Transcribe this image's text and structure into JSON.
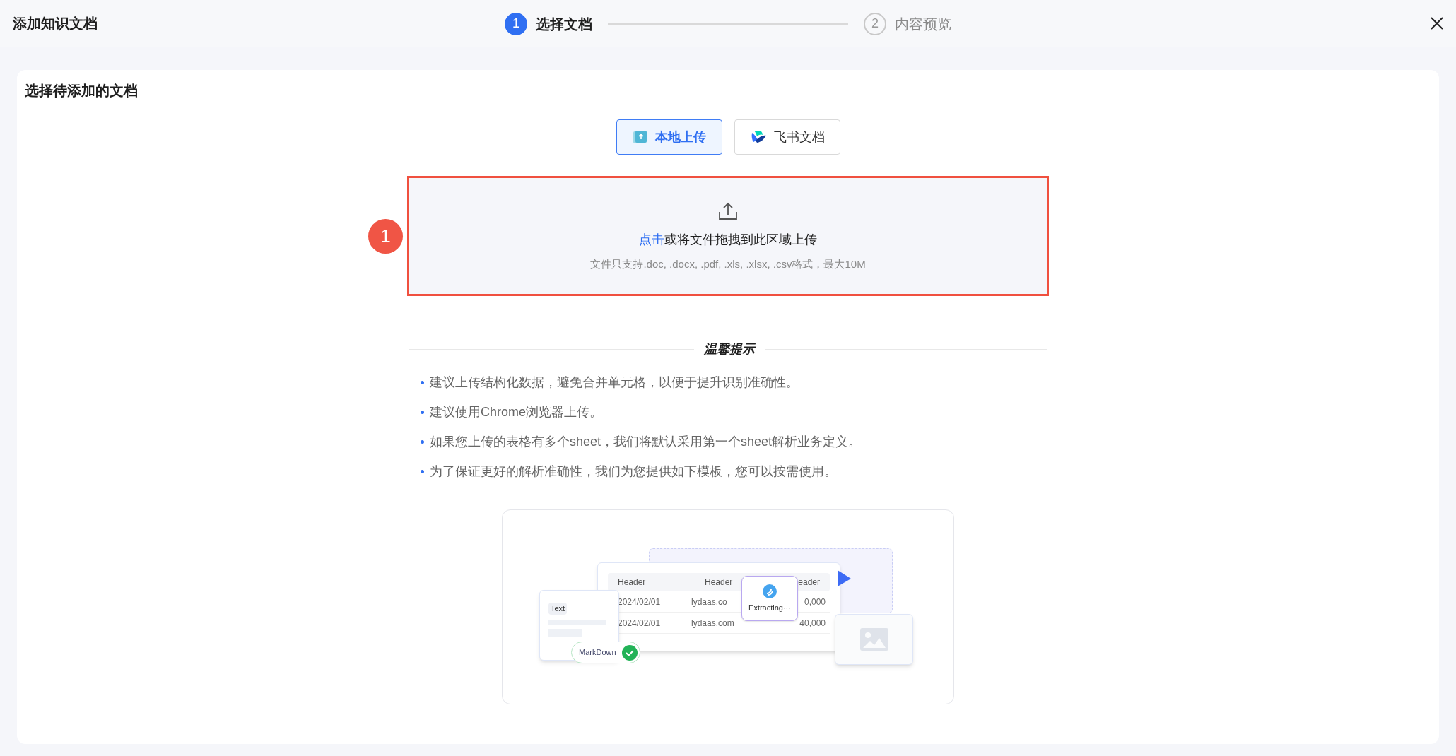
{
  "header": {
    "title": "添加知识文档",
    "steps": [
      {
        "number": "1",
        "label": "选择文档",
        "selected": true
      },
      {
        "number": "2",
        "label": "内容预览",
        "selected": false
      }
    ]
  },
  "panel": {
    "title": "选择待添加的文档",
    "sources": [
      {
        "label": "本地上传",
        "kind": "local",
        "selected": true
      },
      {
        "label": "飞书文档",
        "kind": "feishu",
        "selected": false
      }
    ],
    "dropzone": {
      "link": "点击",
      "text": "或将文件拖拽到此区域上传",
      "hint": "文件只支持.doc, .docx, .pdf, .xls, .xlsx, .csv格式，最大10M",
      "highlighted": true
    },
    "annotation": "1",
    "tips_title": "温馨提示",
    "tips": [
      "建议上传结构化数据，避免合并单元格，以便于提升识别准确性。",
      "建议使用Chrome浏览器上传。",
      "如果您上传的表格有多个sheet，我们将默认采用第一个sheet解析业务定义。",
      "为了保证更好的解析准确性，我们为您提供如下模板，您可以按需使用。"
    ],
    "illustration": {
      "headers": [
        "Header",
        "Header",
        "eader"
      ],
      "rows": [
        [
          "2024/02/01",
          "lydaas.co",
          "0,000"
        ],
        [
          "2024/02/01",
          "lydaas.com",
          "40,000"
        ]
      ],
      "text_tag": "Text",
      "markdown": "MarkDown",
      "extracting": "Extracting···"
    }
  }
}
